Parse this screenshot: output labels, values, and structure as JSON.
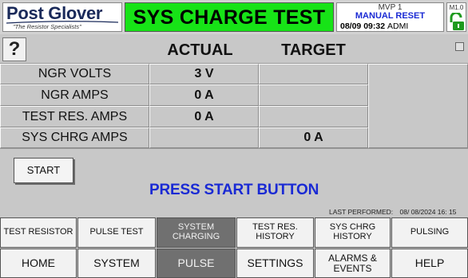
{
  "header": {
    "logo_text": "Post Glover",
    "logo_tagline": "\"The Resistor Specialists\"",
    "title": "SYS CHARGE TEST",
    "unit": "MVP 1",
    "reset_mode": "MANUAL RESET",
    "datetime": "08/09 09:32",
    "user": "ADMI",
    "version": "M1.0",
    "brand_green": "#17e317",
    "accent_blue": "#1a2ad4"
  },
  "columns": {
    "help": "?",
    "actual": "ACTUAL",
    "target": "TARGET"
  },
  "rows": [
    {
      "label": "NGR VOLTS",
      "actual": "3 V",
      "target": ""
    },
    {
      "label": "NGR AMPS",
      "actual": "0 A",
      "target": ""
    },
    {
      "label": "TEST RES. AMPS",
      "actual": "0 A",
      "target": ""
    },
    {
      "label": "SYS CHRG AMPS",
      "actual": "",
      "target": "0 A"
    }
  ],
  "actions": {
    "start": "START",
    "prompt": "PRESS START BUTTON",
    "last_performed_label": "LAST PERFORMED:",
    "last_performed_value": "08/ 08/2024  16: 15"
  },
  "nav_top": [
    "TEST RESISTOR",
    "PULSE TEST",
    "SYSTEM CHARGING",
    "TEST RES. HISTORY",
    "SYS CHRG HISTORY",
    "PULSING"
  ],
  "nav_bottom": [
    "HOME",
    "SYSTEM",
    "PULSE",
    "SETTINGS",
    "ALARMS & EVENTS",
    "HELP"
  ],
  "icons": {
    "help": "question-mark-icon",
    "lock": "unlocked-padlock-icon"
  }
}
